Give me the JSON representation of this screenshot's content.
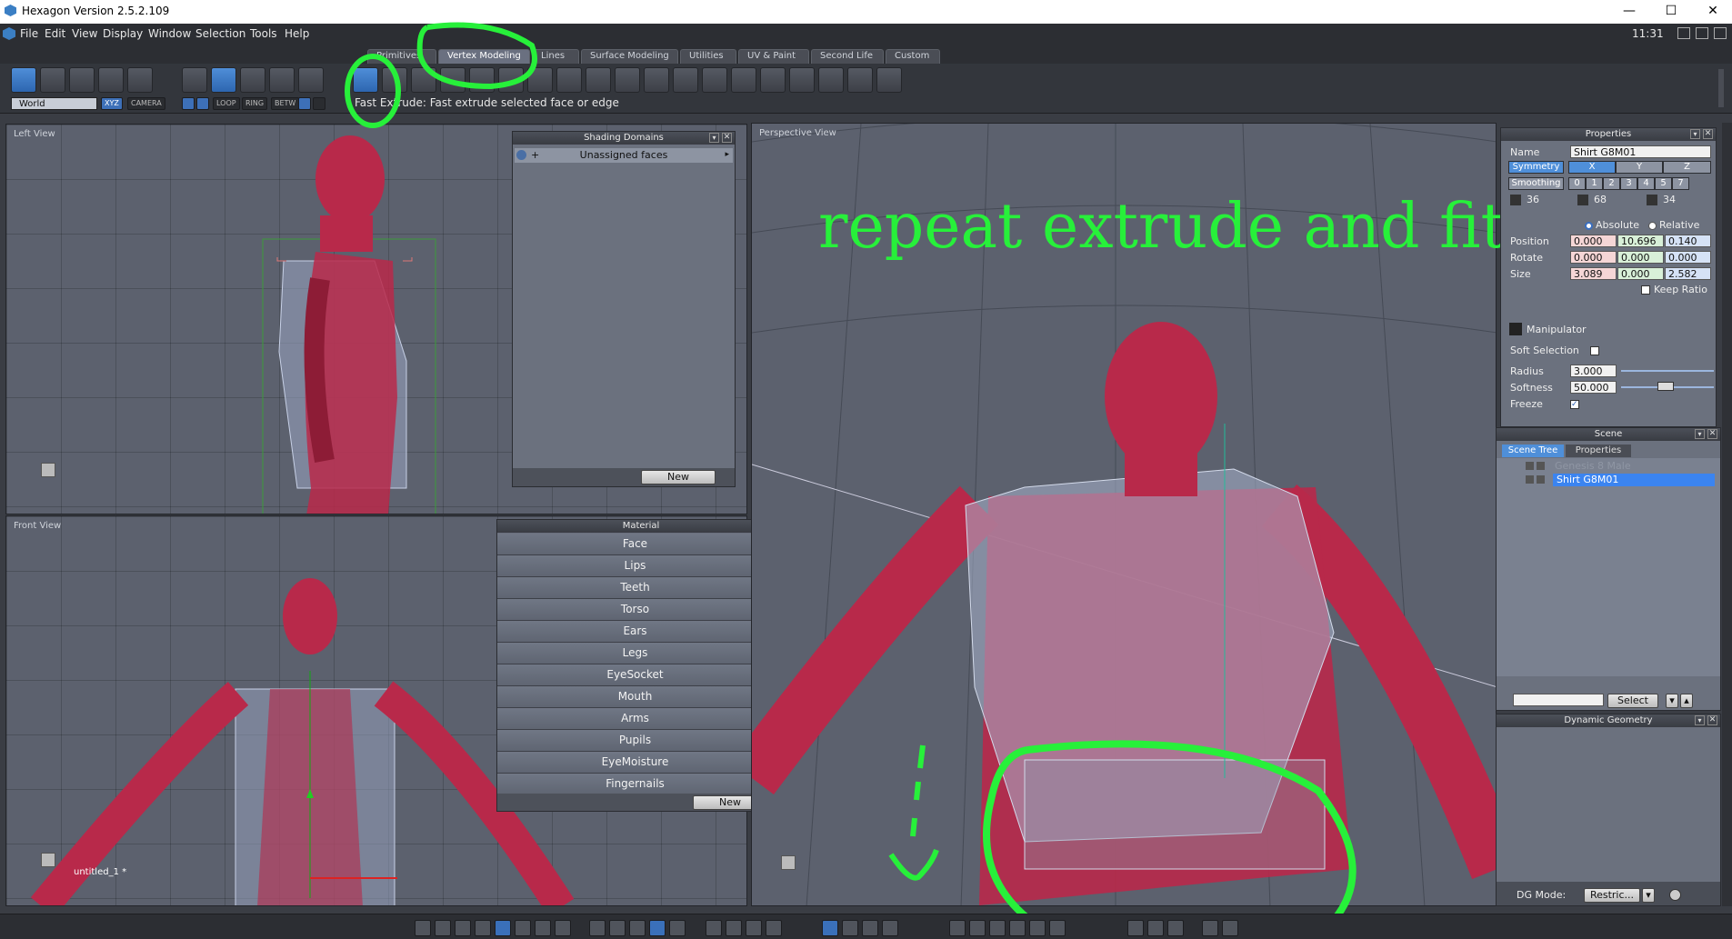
{
  "window": {
    "title": "Hexagon Version 2.5.2.109",
    "minimize": "—",
    "maximize": "☐",
    "close": "✕"
  },
  "menu": [
    "File",
    "Edit",
    "View",
    "Display",
    "Window",
    "Selection",
    "Tools",
    "Help"
  ],
  "clock": "11:31",
  "tabs": [
    "Primitives",
    "Vertex Modeling",
    "Lines",
    "Surface Modeling",
    "Utilities",
    "UV & Paint",
    "Second Life",
    "Custom"
  ],
  "toolbar": {
    "coord_select": "World",
    "xyz": "XYZ",
    "camera": "CAMERA",
    "loop": "LOOP",
    "ring": "RING",
    "betw": "BETW"
  },
  "hint": "Fast Extrude: Fast extrude selected face or edge",
  "viewports": {
    "left": "Left View",
    "front": "Front View",
    "perspective": "Perspective View",
    "front_object": "untitled_1 *"
  },
  "annotation": "repeat extrude and fit",
  "shading_domains": {
    "title": "Shading Domains",
    "row": "Unassigned faces",
    "new": "New"
  },
  "material": {
    "title": "Material",
    "items": [
      "Face",
      "Lips",
      "Teeth",
      "Torso",
      "Ears",
      "Legs",
      "EyeSocket",
      "Mouth",
      "Arms",
      "Pupils",
      "EyeMoisture",
      "Fingernails"
    ],
    "new": "New"
  },
  "properties": {
    "title": "Properties",
    "name_label": "Name",
    "name_value": "Shirt G8M01",
    "symmetry": "Symmetry",
    "sym_axes": [
      "X",
      "Y",
      "Z"
    ],
    "smoothing": "Smoothing",
    "smooth_levels": [
      "0",
      "1",
      "2",
      "3",
      "4",
      "5",
      "7"
    ],
    "counts": [
      "36",
      "68",
      "34"
    ],
    "absolute": "Absolute",
    "relative": "Relative",
    "position": "Position",
    "pos": [
      "0.000",
      "10.696",
      "0.140"
    ],
    "rotate": "Rotate",
    "rot": [
      "0.000",
      "0.000",
      "0.000"
    ],
    "size": "Size",
    "sz": [
      "3.089",
      "0.000",
      "2.582"
    ],
    "keep_ratio": "Keep Ratio",
    "manipulator": "Manipulator",
    "soft_selection": "Soft Selection",
    "radius": "Radius",
    "radius_value": "3.000",
    "softness": "Softness",
    "softness_value": "50.000",
    "freeze": "Freeze"
  },
  "scene": {
    "title": "Scene",
    "tab_tree": "Scene Tree",
    "tab_props": "Properties",
    "items": [
      "Genesis 8 Male",
      "Shirt G8M01"
    ],
    "select": "Select"
  },
  "dynamic_geometry": {
    "title": "Dynamic Geometry",
    "dg_mode": "DG Mode:",
    "dg_value": "Restric..."
  },
  "colors": {
    "accent": "#4f8fd9",
    "annotation": "#27f03a",
    "skin": "#b8294a"
  }
}
